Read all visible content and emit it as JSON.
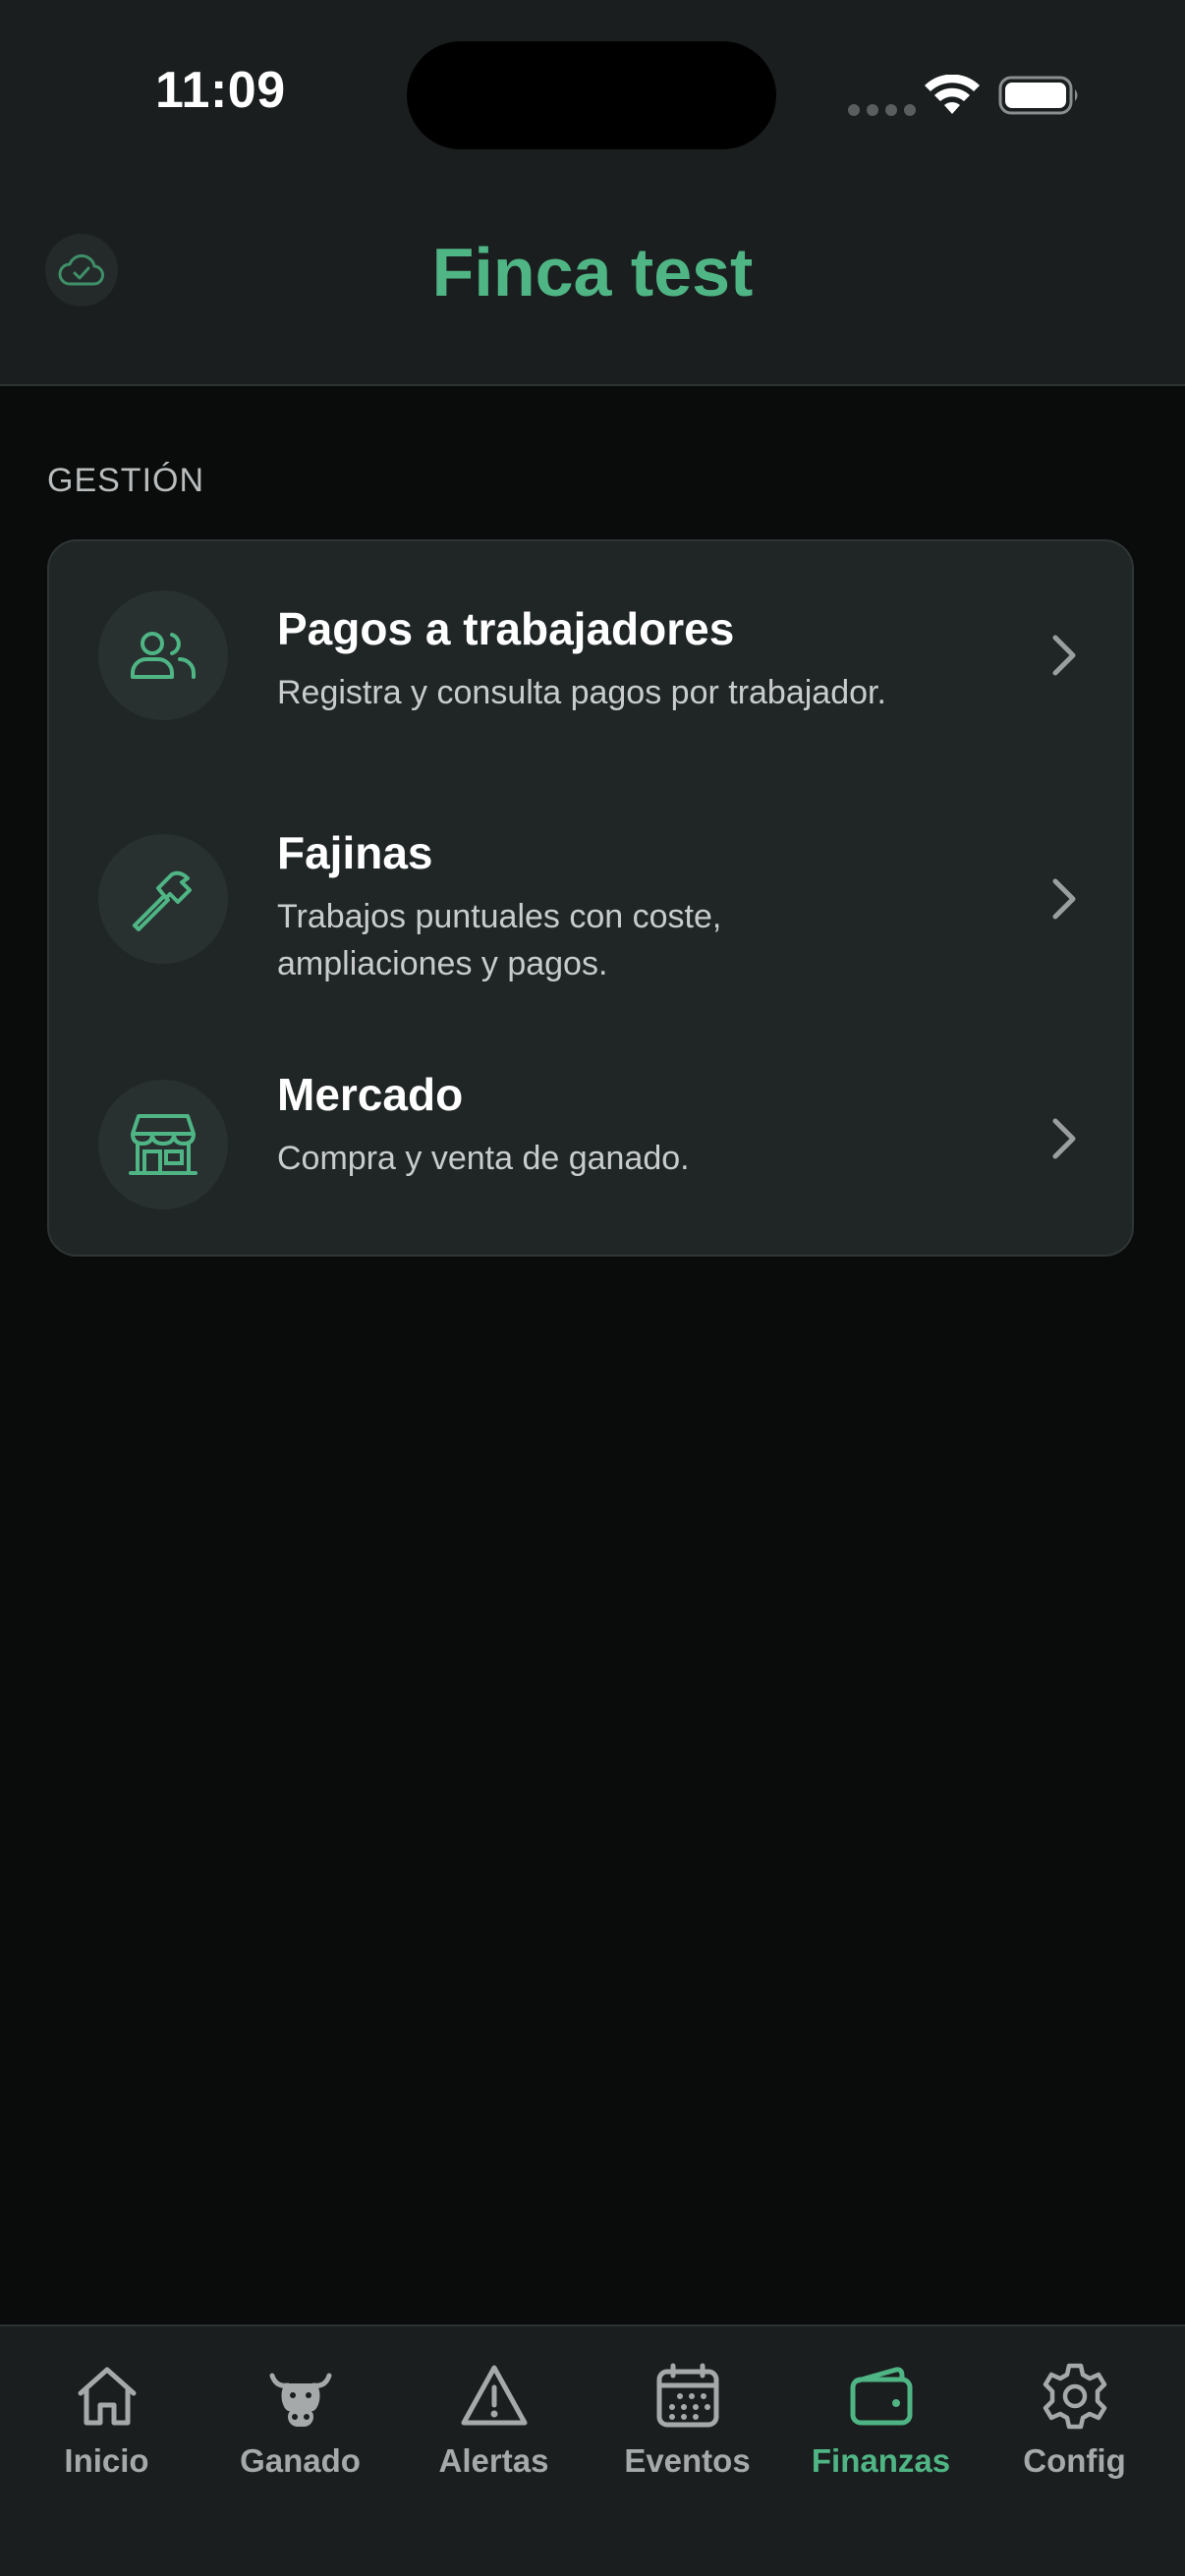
{
  "status_bar": {
    "time": "11:09"
  },
  "header": {
    "title": "Finca test",
    "sync_icon": "cloud-check-icon"
  },
  "section": {
    "label": "GESTIÓN"
  },
  "menu_items": [
    {
      "title": "Pagos a trabajadores",
      "description": "Registra y consulta pagos por trabajador.",
      "icon": "users-icon"
    },
    {
      "title": "Fajinas",
      "description": "Trabajos puntuales con coste, ampliaciones y pagos.",
      "icon": "hammer-icon"
    },
    {
      "title": "Mercado",
      "description": "Compra y venta de ganado.",
      "icon": "store-icon"
    }
  ],
  "tabs": [
    {
      "label": "Inicio",
      "icon": "home-icon",
      "active": false
    },
    {
      "label": "Ganado",
      "icon": "cow-icon",
      "active": false
    },
    {
      "label": "Alertas",
      "icon": "warning-icon",
      "active": false
    },
    {
      "label": "Eventos",
      "icon": "calendar-icon",
      "active": false
    },
    {
      "label": "Finanzas",
      "icon": "wallet-icon",
      "active": true
    },
    {
      "label": "Config",
      "icon": "gear-icon",
      "active": false
    }
  ],
  "colors": {
    "accent": "#4fb585",
    "background": "#0a0c0c",
    "surface": "#202626",
    "header": "#1a1e1e",
    "muted_text": "#a5a9a9"
  }
}
